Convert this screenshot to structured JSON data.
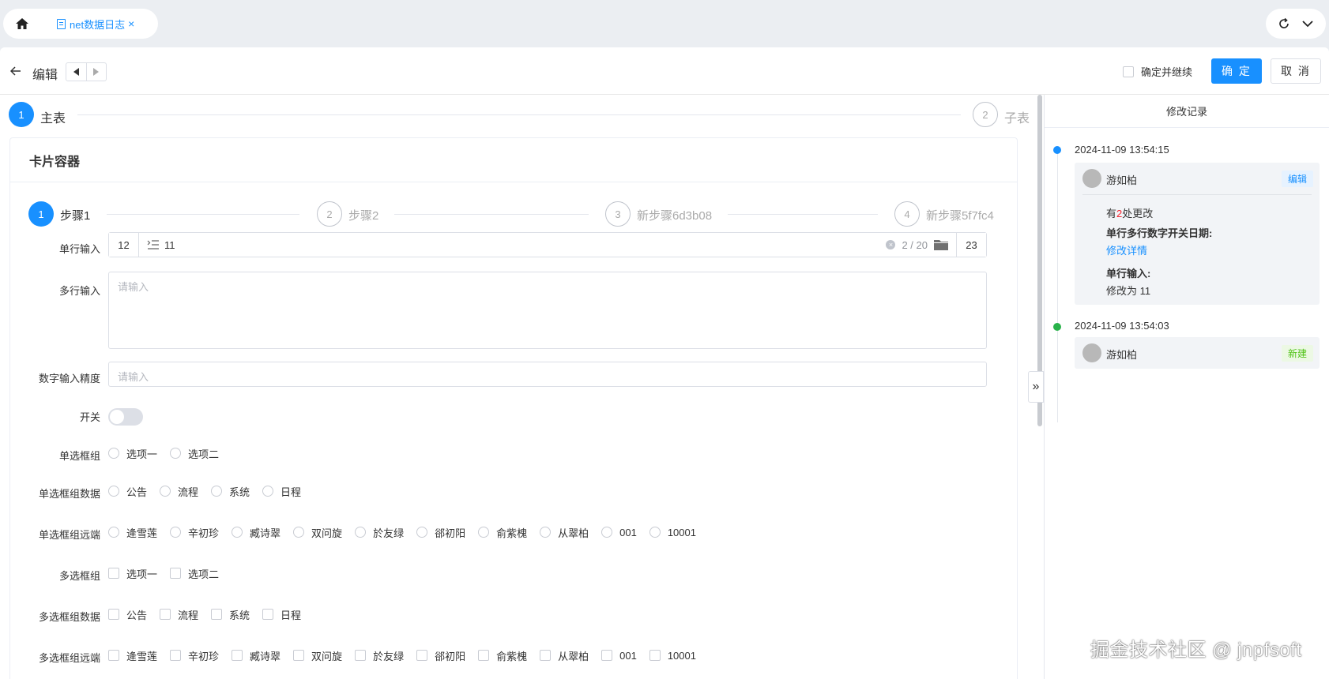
{
  "tabs": {
    "active_tab": "net数据日志",
    "close": "×"
  },
  "header": {
    "title": "编辑",
    "continue_label": "确定并继续",
    "confirm_label": "确 定",
    "cancel_label": "取 消"
  },
  "outer_steps": [
    {
      "num": "1",
      "label": "主表"
    },
    {
      "num": "2",
      "label": "子表"
    }
  ],
  "card": {
    "title": "卡片容器",
    "steps": [
      {
        "num": "1",
        "label": "步骤1"
      },
      {
        "num": "2",
        "label": "步骤2"
      },
      {
        "num": "3",
        "label": "新步骤6d3b08"
      },
      {
        "num": "4",
        "label": "新步骤5f7fc4"
      }
    ]
  },
  "form": {
    "single_input": {
      "label": "单行输入",
      "prefix": "12",
      "value": "11",
      "count": "2 / 20",
      "suffix": "23"
    },
    "multi_input": {
      "label": "多行输入",
      "placeholder": "请输入"
    },
    "number_input": {
      "label": "数字输入精度",
      "placeholder": "请输入"
    },
    "switch": {
      "label": "开关",
      "value": false
    },
    "radio_group": {
      "label": "单选框组",
      "options": [
        "选项一",
        "选项二"
      ]
    },
    "radio_group_data": {
      "label": "单选框组数据",
      "options": [
        "公告",
        "流程",
        "系统",
        "日程"
      ]
    },
    "radio_group_remote": {
      "label": "单选框组远端",
      "options": [
        "逄雪莲",
        "辛初珍",
        "臧诗翠",
        "双问旋",
        "於友绿",
        "郤初阳",
        "俞紫槐",
        "从翠柏",
        "001",
        "10001"
      ]
    },
    "check_group": {
      "label": "多选框组",
      "options": [
        "选项一",
        "选项二"
      ]
    },
    "check_group_data": {
      "label": "多选框组数据",
      "options": [
        "公告",
        "流程",
        "系统",
        "日程"
      ]
    },
    "check_group_remote": {
      "label": "多选框组远端",
      "options": [
        "逄雪莲",
        "辛初珍",
        "臧诗翠",
        "双问旋",
        "於友绿",
        "郤初阳",
        "俞紫槐",
        "从翠柏",
        "001",
        "10001"
      ]
    }
  },
  "history": {
    "title": "修改记录",
    "entries": [
      {
        "time": "2024-11-09 13:54:15",
        "user": "游如柏",
        "tag": "编辑",
        "summary_pre": "有",
        "summary_count": "2",
        "summary_post": "处更改",
        "field1": "单行多行数字开关日期:",
        "field1_link": "修改详情",
        "field2": "单行输入:",
        "field2_change": "修改为 11"
      },
      {
        "time": "2024-11-09 13:54:03",
        "user": "游如柏",
        "tag": "新建"
      }
    ]
  },
  "watermark": "掘金技术社区 @ jnpfsoft",
  "colors": {
    "primary": "#1890ff",
    "success": "#52c41a",
    "danger": "#f5222d"
  }
}
